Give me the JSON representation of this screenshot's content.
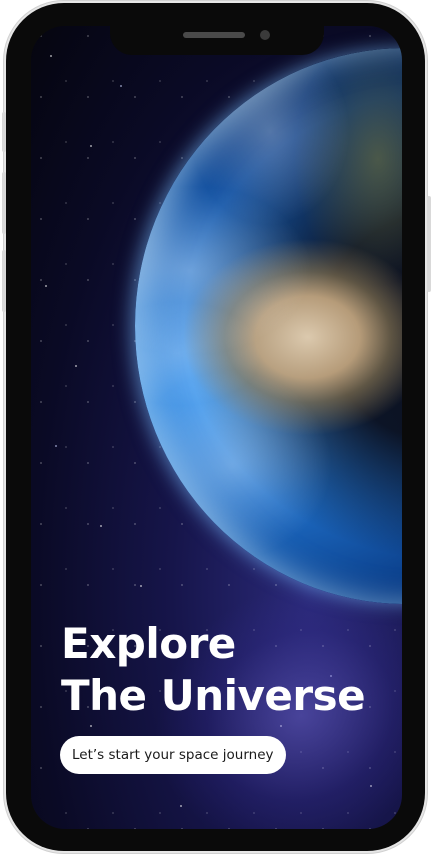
{
  "app": {
    "title_line1": "Explore",
    "title_line2": "The Universe",
    "cta_label": "Let’s start your space journey"
  },
  "colors": {
    "background": "#0a0a25",
    "text": "#ffffff",
    "button_bg": "#ffffff",
    "button_text": "#1a1a1a"
  },
  "icons": {
    "earth": "earth-globe-image",
    "camera": "front-camera-dot",
    "speaker": "earpiece-speaker"
  }
}
